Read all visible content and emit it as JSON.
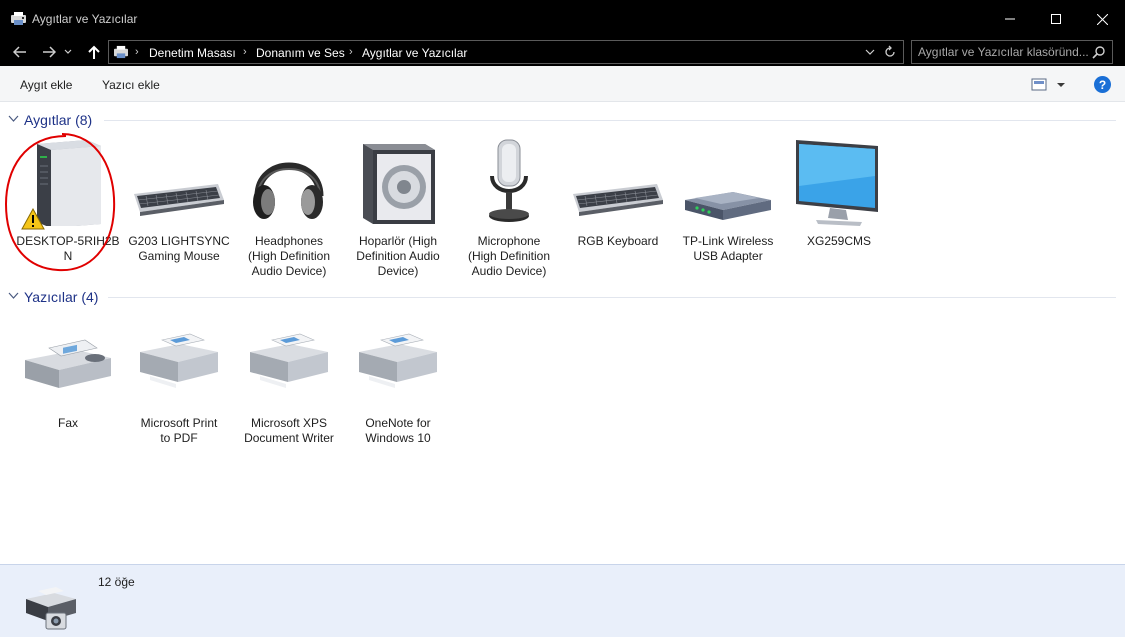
{
  "window": {
    "title": "Aygıtlar ve Yazıcılar"
  },
  "address": {
    "crumbs": [
      "Denetim Masası",
      "Donanım ve Ses",
      "Aygıtlar ve Yazıcılar"
    ],
    "search_placeholder": "Aygıtlar ve Yazıcılar klasöründ..."
  },
  "commands": {
    "add_device": "Aygıt ekle",
    "add_printer": "Yazıcı ekle",
    "help": "?"
  },
  "groups": {
    "devices": {
      "title": "Aygıtlar (8)",
      "items": [
        {
          "label_lines": [
            "DESKTOP-5RIH2B",
            "N"
          ],
          "icon": "computer-tower-icon",
          "warning": true
        },
        {
          "label_lines": [
            "G203 LIGHTSYNC",
            "Gaming Mouse"
          ],
          "icon": "keyboard-icon"
        },
        {
          "label_lines": [
            "Headphones",
            "(High Definition",
            "Audio Device)"
          ],
          "icon": "headphones-icon"
        },
        {
          "label_lines": [
            "Hoparlör (High",
            "Definition Audio",
            "Device)"
          ],
          "icon": "speaker-icon"
        },
        {
          "label_lines": [
            "Microphone",
            "(High Definition",
            "Audio Device)"
          ],
          "icon": "microphone-icon"
        },
        {
          "label_lines": [
            "RGB Keyboard"
          ],
          "icon": "keyboard-icon"
        },
        {
          "label_lines": [
            "TP-Link Wireless",
            "USB Adapter"
          ],
          "icon": "network-adapter-icon"
        },
        {
          "label_lines": [
            "XG259CMS"
          ],
          "icon": "monitor-icon"
        }
      ]
    },
    "printers": {
      "title": "Yazıcılar (4)",
      "items": [
        {
          "label_lines": [
            "Fax"
          ],
          "icon": "fax-icon"
        },
        {
          "label_lines": [
            "Microsoft Print",
            "to PDF"
          ],
          "icon": "printer-icon"
        },
        {
          "label_lines": [
            "Microsoft XPS",
            "Document Writer"
          ],
          "icon": "printer-icon"
        },
        {
          "label_lines": [
            "OneNote for",
            "Windows 10"
          ],
          "icon": "printer-icon"
        }
      ]
    }
  },
  "details": {
    "count": "12 öğe"
  },
  "colors": {
    "group_title": "#1e3287",
    "annotation": "#e00000",
    "details_bg": "#e9effa"
  }
}
